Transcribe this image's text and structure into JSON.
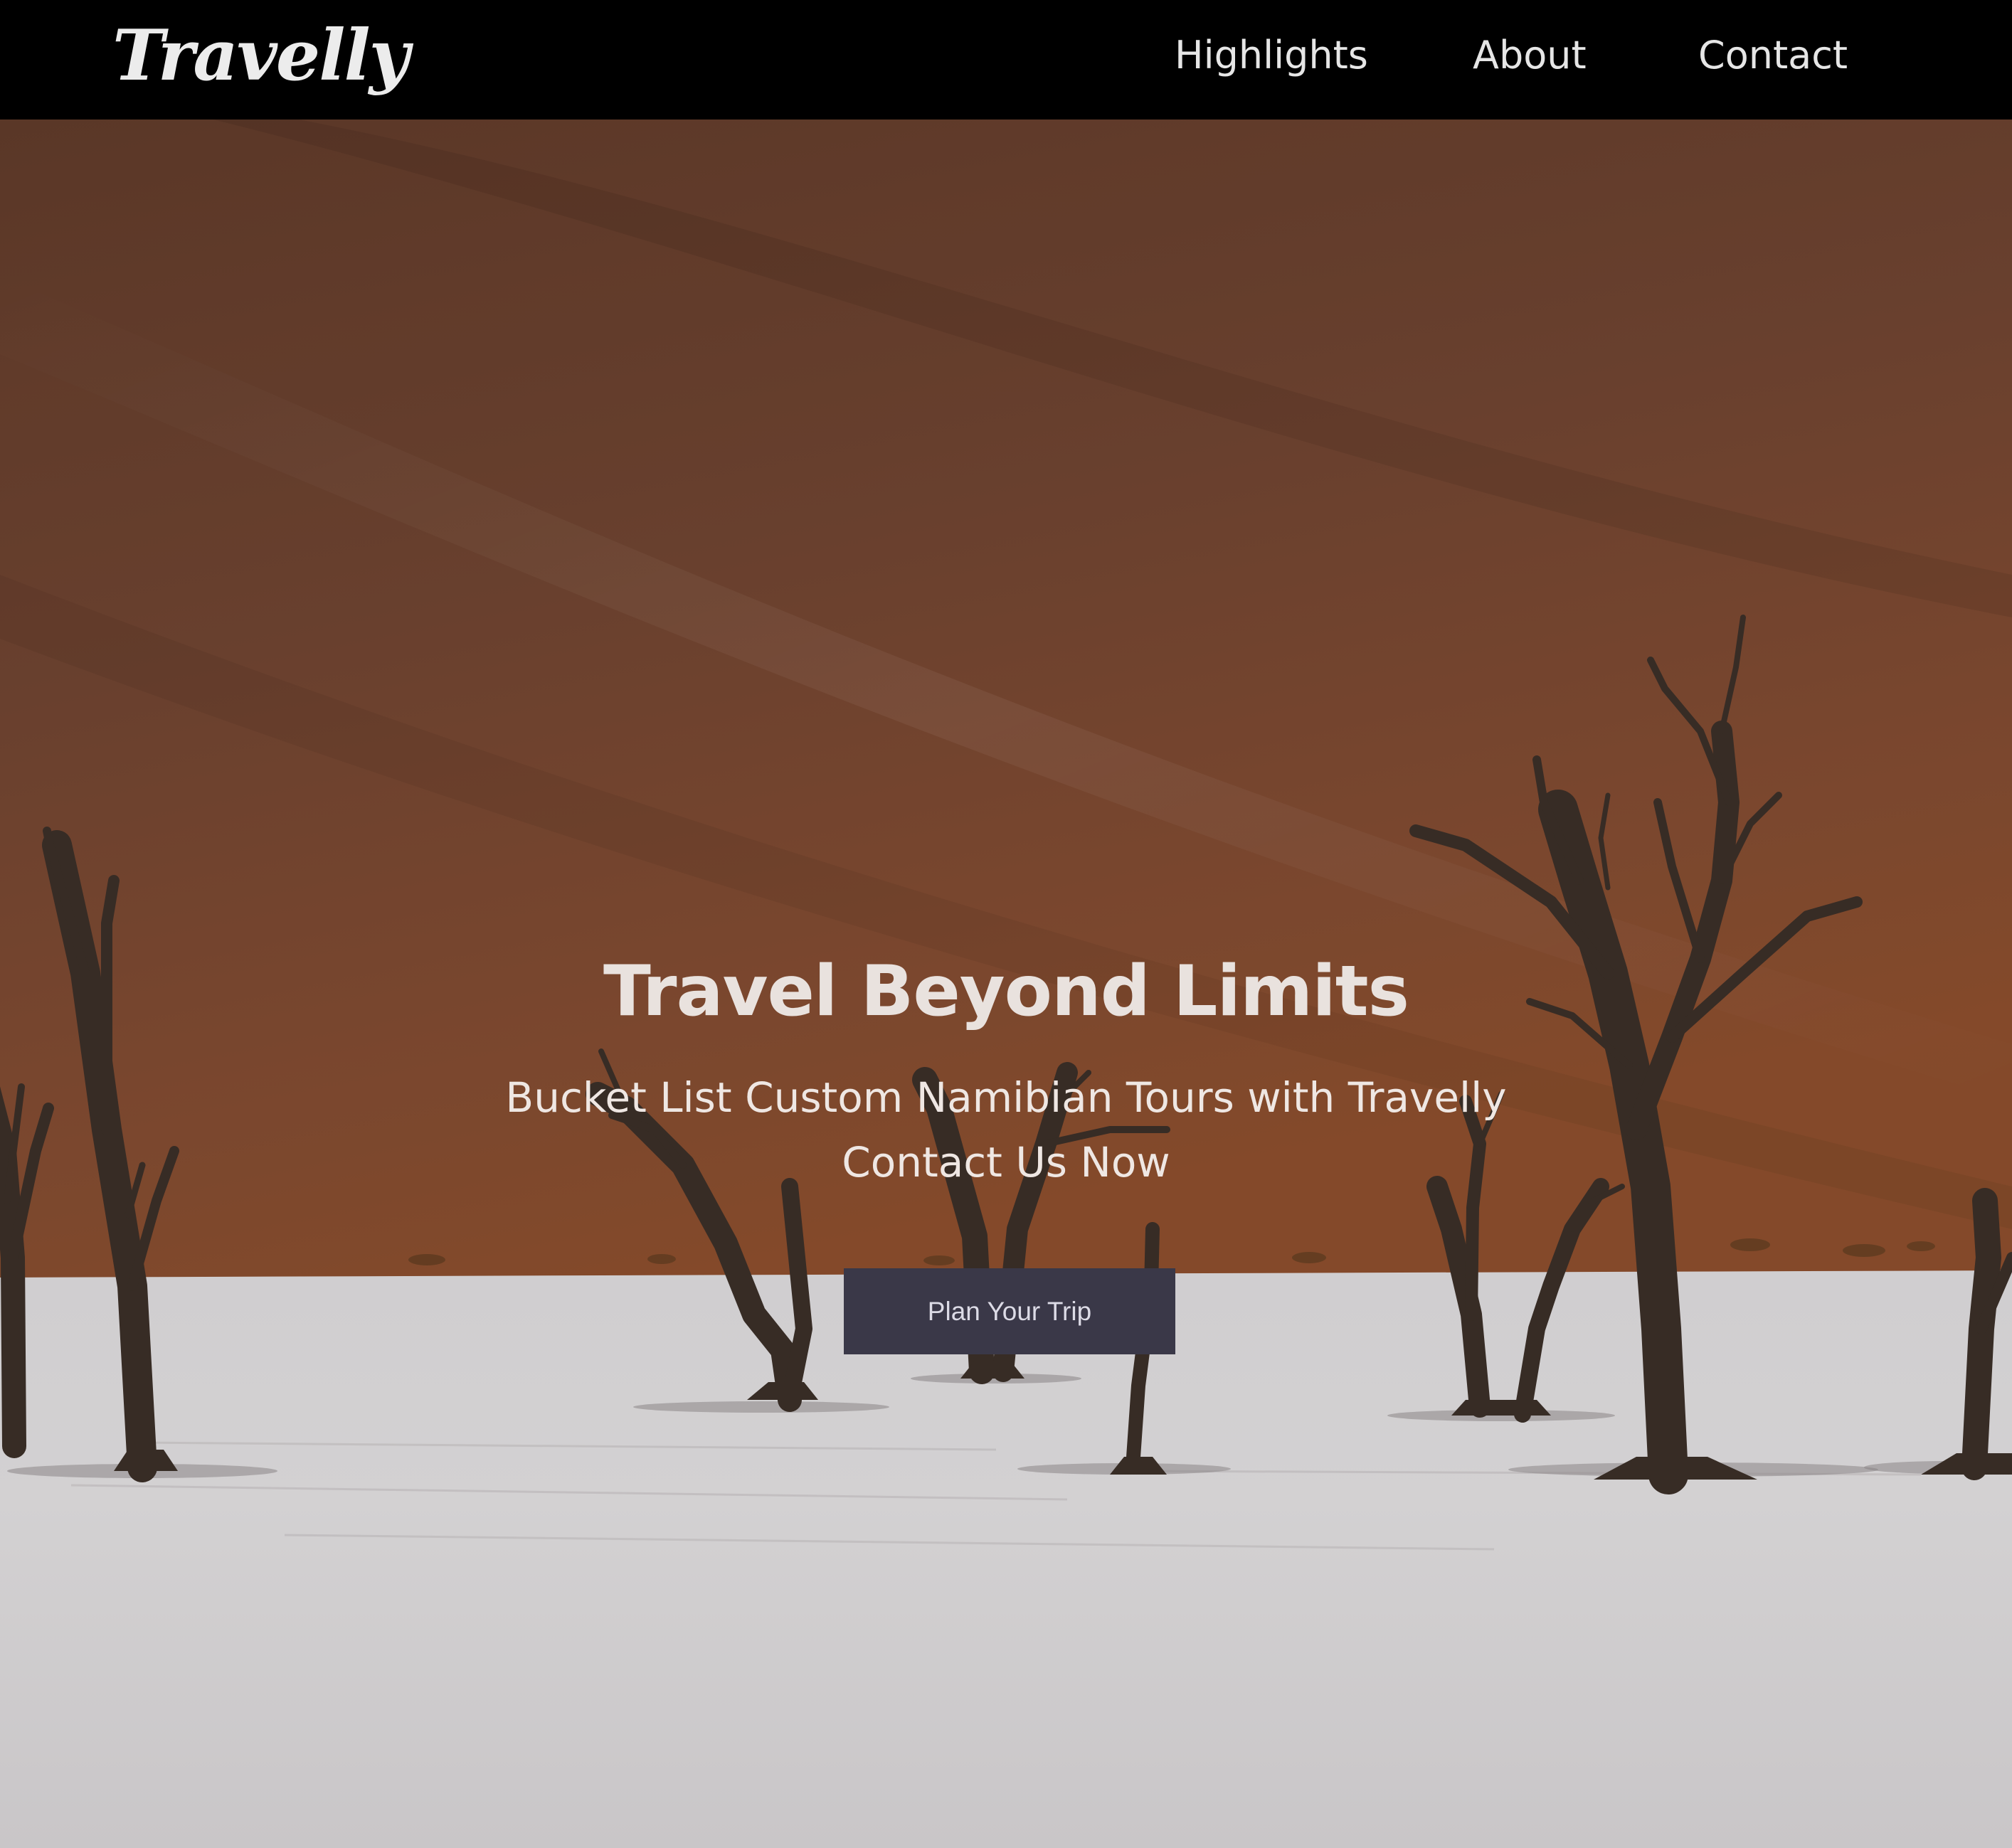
{
  "nav": {
    "logo": "Travelly",
    "links": [
      {
        "label": "Highlights"
      },
      {
        "label": "About"
      },
      {
        "label": "Contact"
      }
    ]
  },
  "hero": {
    "title": "Travel Beyond Limits",
    "subtitle_line1": "Bucket List Custom Namibian Tours with Travelly",
    "subtitle_line2": "Contact Us Now",
    "button_label": "Plan Your Trip",
    "background_description_icon": "desert-dead-trees-photo"
  },
  "colors": {
    "nav_bg": "#000000",
    "dune": "#7a432a",
    "salt_pan": "#dcdadb",
    "tree": "#3a2e27",
    "button_bg": "#3a3848"
  }
}
